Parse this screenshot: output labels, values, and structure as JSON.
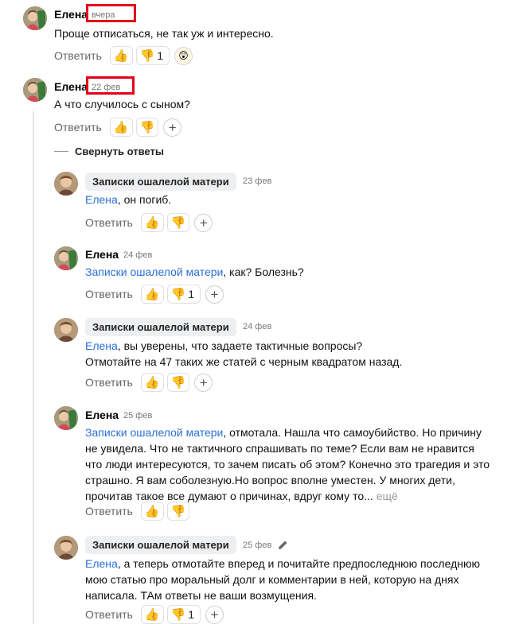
{
  "reply_label": "Ответить",
  "reactions": {
    "like_icon": "👍",
    "dislike_icon": "👎"
  },
  "collapse_label": "Свернуть ответы",
  "comments": [
    {
      "author": "Елена",
      "date": "вчера",
      "text": "Проще отписаться, не так уж и интересно.",
      "dislike_count": "1",
      "extra_reaction": "😲"
    },
    {
      "author": "Елена",
      "date": "22 фев",
      "text": "А что случилось с сыном?"
    },
    {
      "author": "Записки ошалелой матери",
      "date": "23 фев",
      "mention": "Елена",
      "text": ", он погиб."
    },
    {
      "author": "Елена",
      "date": "24 фев",
      "mention": "Записки ошалелой матери",
      "text": ", как? Болезнь?",
      "dislike_count": "1"
    },
    {
      "author": "Записки ошалелой матери",
      "date": "24 фев",
      "mention": "Елена",
      "text": ", вы уверены, что задаете тактичные вопросы?",
      "text2": "Отмотайте на 47 таких же статей с черным квадратом назад."
    },
    {
      "author": "Елена",
      "date": "25 фев",
      "mention": "Записки ошалелой матери",
      "text": ", отмотала. Нашла что самоубийство. Но причину не увидела. Что не тактичного спрашивать по теме? Если вам не нравится что люди интересуются, то зачем писать об этом? Конечно это трагедия и это страшно. Я вам соболезную.Но вопрос вполне уместен. У многих дети, прочитав такое все думают о причинах, вдруг кому то...",
      "more": "ещё"
    },
    {
      "author": "Записки ошалелой матери",
      "date": "25 фев",
      "mention": "Елена",
      "text": ", а теперь отмотайте вперед и почитайте предпоследнюю последнюю мою статью про моральный долг и комментарии в ней, которую на днях написала. ТАм ответы не ваши возмущения.",
      "dislike_count": "1"
    }
  ]
}
